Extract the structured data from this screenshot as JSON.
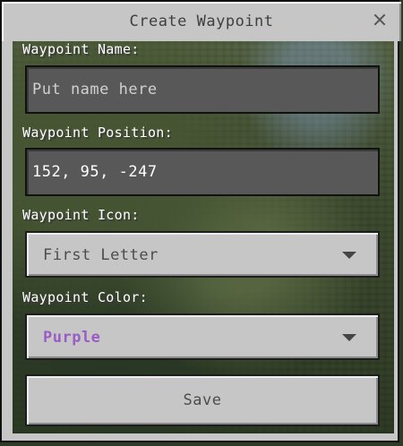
{
  "dialog": {
    "title": "Create Waypoint",
    "close_icon": "close-icon"
  },
  "name_field": {
    "label": "Waypoint Name:",
    "placeholder": "Put name here",
    "value": ""
  },
  "position_field": {
    "label": "Waypoint Position:",
    "value": "152, 95, -247"
  },
  "icon_select": {
    "label": "Waypoint Icon:",
    "selected": "First Letter",
    "chevron_icon": "chevron-down-icon"
  },
  "color_select": {
    "label": "Waypoint Color:",
    "selected": "Purple",
    "selected_color": "#9a5cc6",
    "chevron_icon": "chevron-down-icon"
  },
  "actions": {
    "save_label": "Save"
  }
}
